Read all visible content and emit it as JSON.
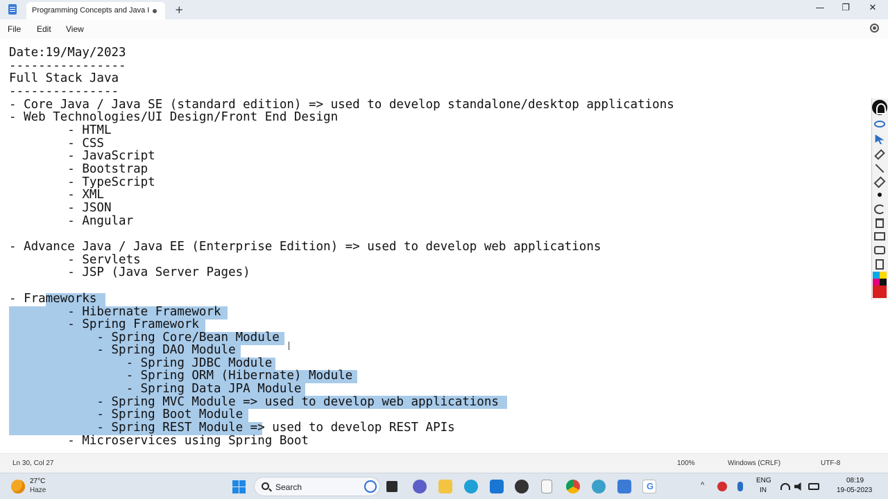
{
  "window": {
    "tab_title": "Programming Concepts and Java Ir",
    "new_tab": "+",
    "minimize": "—",
    "maximize": "❐",
    "close": "✕"
  },
  "menu": {
    "file": "File",
    "edit": "Edit",
    "view": "View"
  },
  "editor": {
    "lines": [
      "Date:19/May/2023",
      "----------------",
      "Full Stack Java",
      "---------------",
      "- Core Java / Java SE (standard edition) => used to develop standalone/desktop applications",
      "- Web Technologies/UI Design/Front End Design",
      "        - HTML",
      "        - CSS",
      "        - JavaScript",
      "        - Bootstrap",
      "        - TypeScript",
      "        - XML",
      "        - JSON",
      "        - Angular",
      "",
      "- Advance Java / Java EE (Enterprise Edition) => used to develop web applications",
      "        - Servlets",
      "        - JSP (Java Server Pages)",
      "",
      "- Frameworks",
      "        - Hibernate Framework",
      "        - Spring Framework",
      "            - Spring Core/Bean Module",
      "            - Spring DAO Module",
      "                - Spring JDBC Module",
      "                - Spring ORM (Hibernate) Module",
      "                - Spring Data JPA Module",
      "            - Spring MVC Module => used to develop web applications",
      "            - Spring Boot Module",
      "            - Spring REST Module => used to develop REST APIs",
      "        - Microservices using Spring Boot"
    ]
  },
  "status": {
    "position": "Ln 30, Col 27",
    "zoom": "100%",
    "line_ending": "Windows (CRLF)",
    "encoding": "UTF-8"
  },
  "taskbar": {
    "weather_temp": "27°C",
    "weather_condition": "Haze",
    "search_label": "Search",
    "lang_line1": "ENG",
    "lang_line2": "IN",
    "time": "08:19",
    "date": "19-05-2023",
    "chrome_g_label": "G"
  },
  "colors": {
    "selection": "#a9cbea",
    "accent": "#2a6fc4"
  }
}
